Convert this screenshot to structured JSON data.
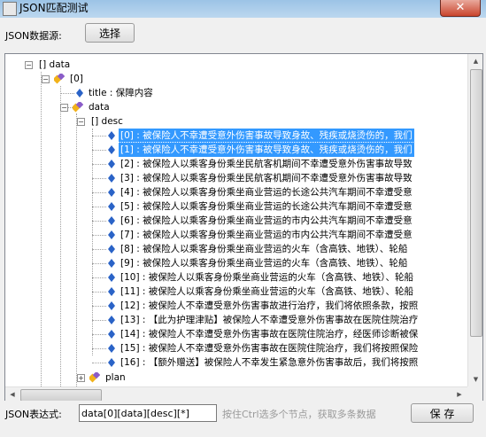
{
  "window": {
    "title": "JSON匹配测试",
    "close_label": "✕"
  },
  "source": {
    "label": "JSON数据源:",
    "select_button": "选择"
  },
  "tree": {
    "root": "[] data",
    "item0": "[0]",
    "title_node": "title : 保障内容",
    "data_node": "data",
    "desc_node": "[] desc",
    "plan_node": "plan",
    "items": [
      "[0] : 被保险人不幸遭受意外伤害事故导致身故、残疾或烧烫伤的，我们",
      "[1] : 被保险人不幸遭受意外伤害事故导致身故、残疾或烧烫伤的，我们",
      "[2] : 被保险人以乘客身份乘坐民航客机期间不幸遭受意外伤害事故导致",
      "[3] : 被保险人以乘客身份乘坐民航客机期间不幸遭受意外伤害事故导致",
      "[4] : 被保险人以乘客身份乘坐商业营运的长途公共汽车期间不幸遭受意",
      "[5] : 被保险人以乘客身份乘坐商业营运的长途公共汽车期间不幸遭受意",
      "[6] : 被保险人以乘客身份乘坐商业营运的市内公共汽车期间不幸遭受意",
      "[7] : 被保险人以乘客身份乘坐商业营运的市内公共汽车期间不幸遭受意",
      "[8] : 被保险人以乘客身份乘坐商业营运的火车（含高铁、地铁）、轮船",
      "[9] : 被保险人以乘客身份乘坐商业营运的火车（含高铁、地铁）、轮船",
      "[10] : 被保险人以乘客身份乘坐商业营运的火车（含高铁、地铁）、轮船",
      "[11] : 被保险人以乘客身份乘坐商业营运的火车（含高铁、地铁）、轮船",
      "[12] : 被保险人不幸遭受意外伤害事故进行治疗，我们将依照条款，按照",
      "[13] : 【此为护理津贴】被保险人不幸遭受意外伤害事故在医院住院治疗",
      "[14] : 被保险人不幸遭受意外伤害事故在医院住院治疗，经医师诊断被保",
      "[15] : 被保险人不幸遭受意外伤害事故在医院住院治疗，我们将按照保险",
      "[16] : 【额外赠送】被保险人不幸发生紧急意外伤害事故后，我们将按照"
    ],
    "selected_indices": [
      0,
      1
    ]
  },
  "expression": {
    "label": "JSON表达式:",
    "value": "data[0][data][desc][*]"
  },
  "hint": "按住Ctrl选多个节点，获取多条数据",
  "save_button": "保 存"
}
